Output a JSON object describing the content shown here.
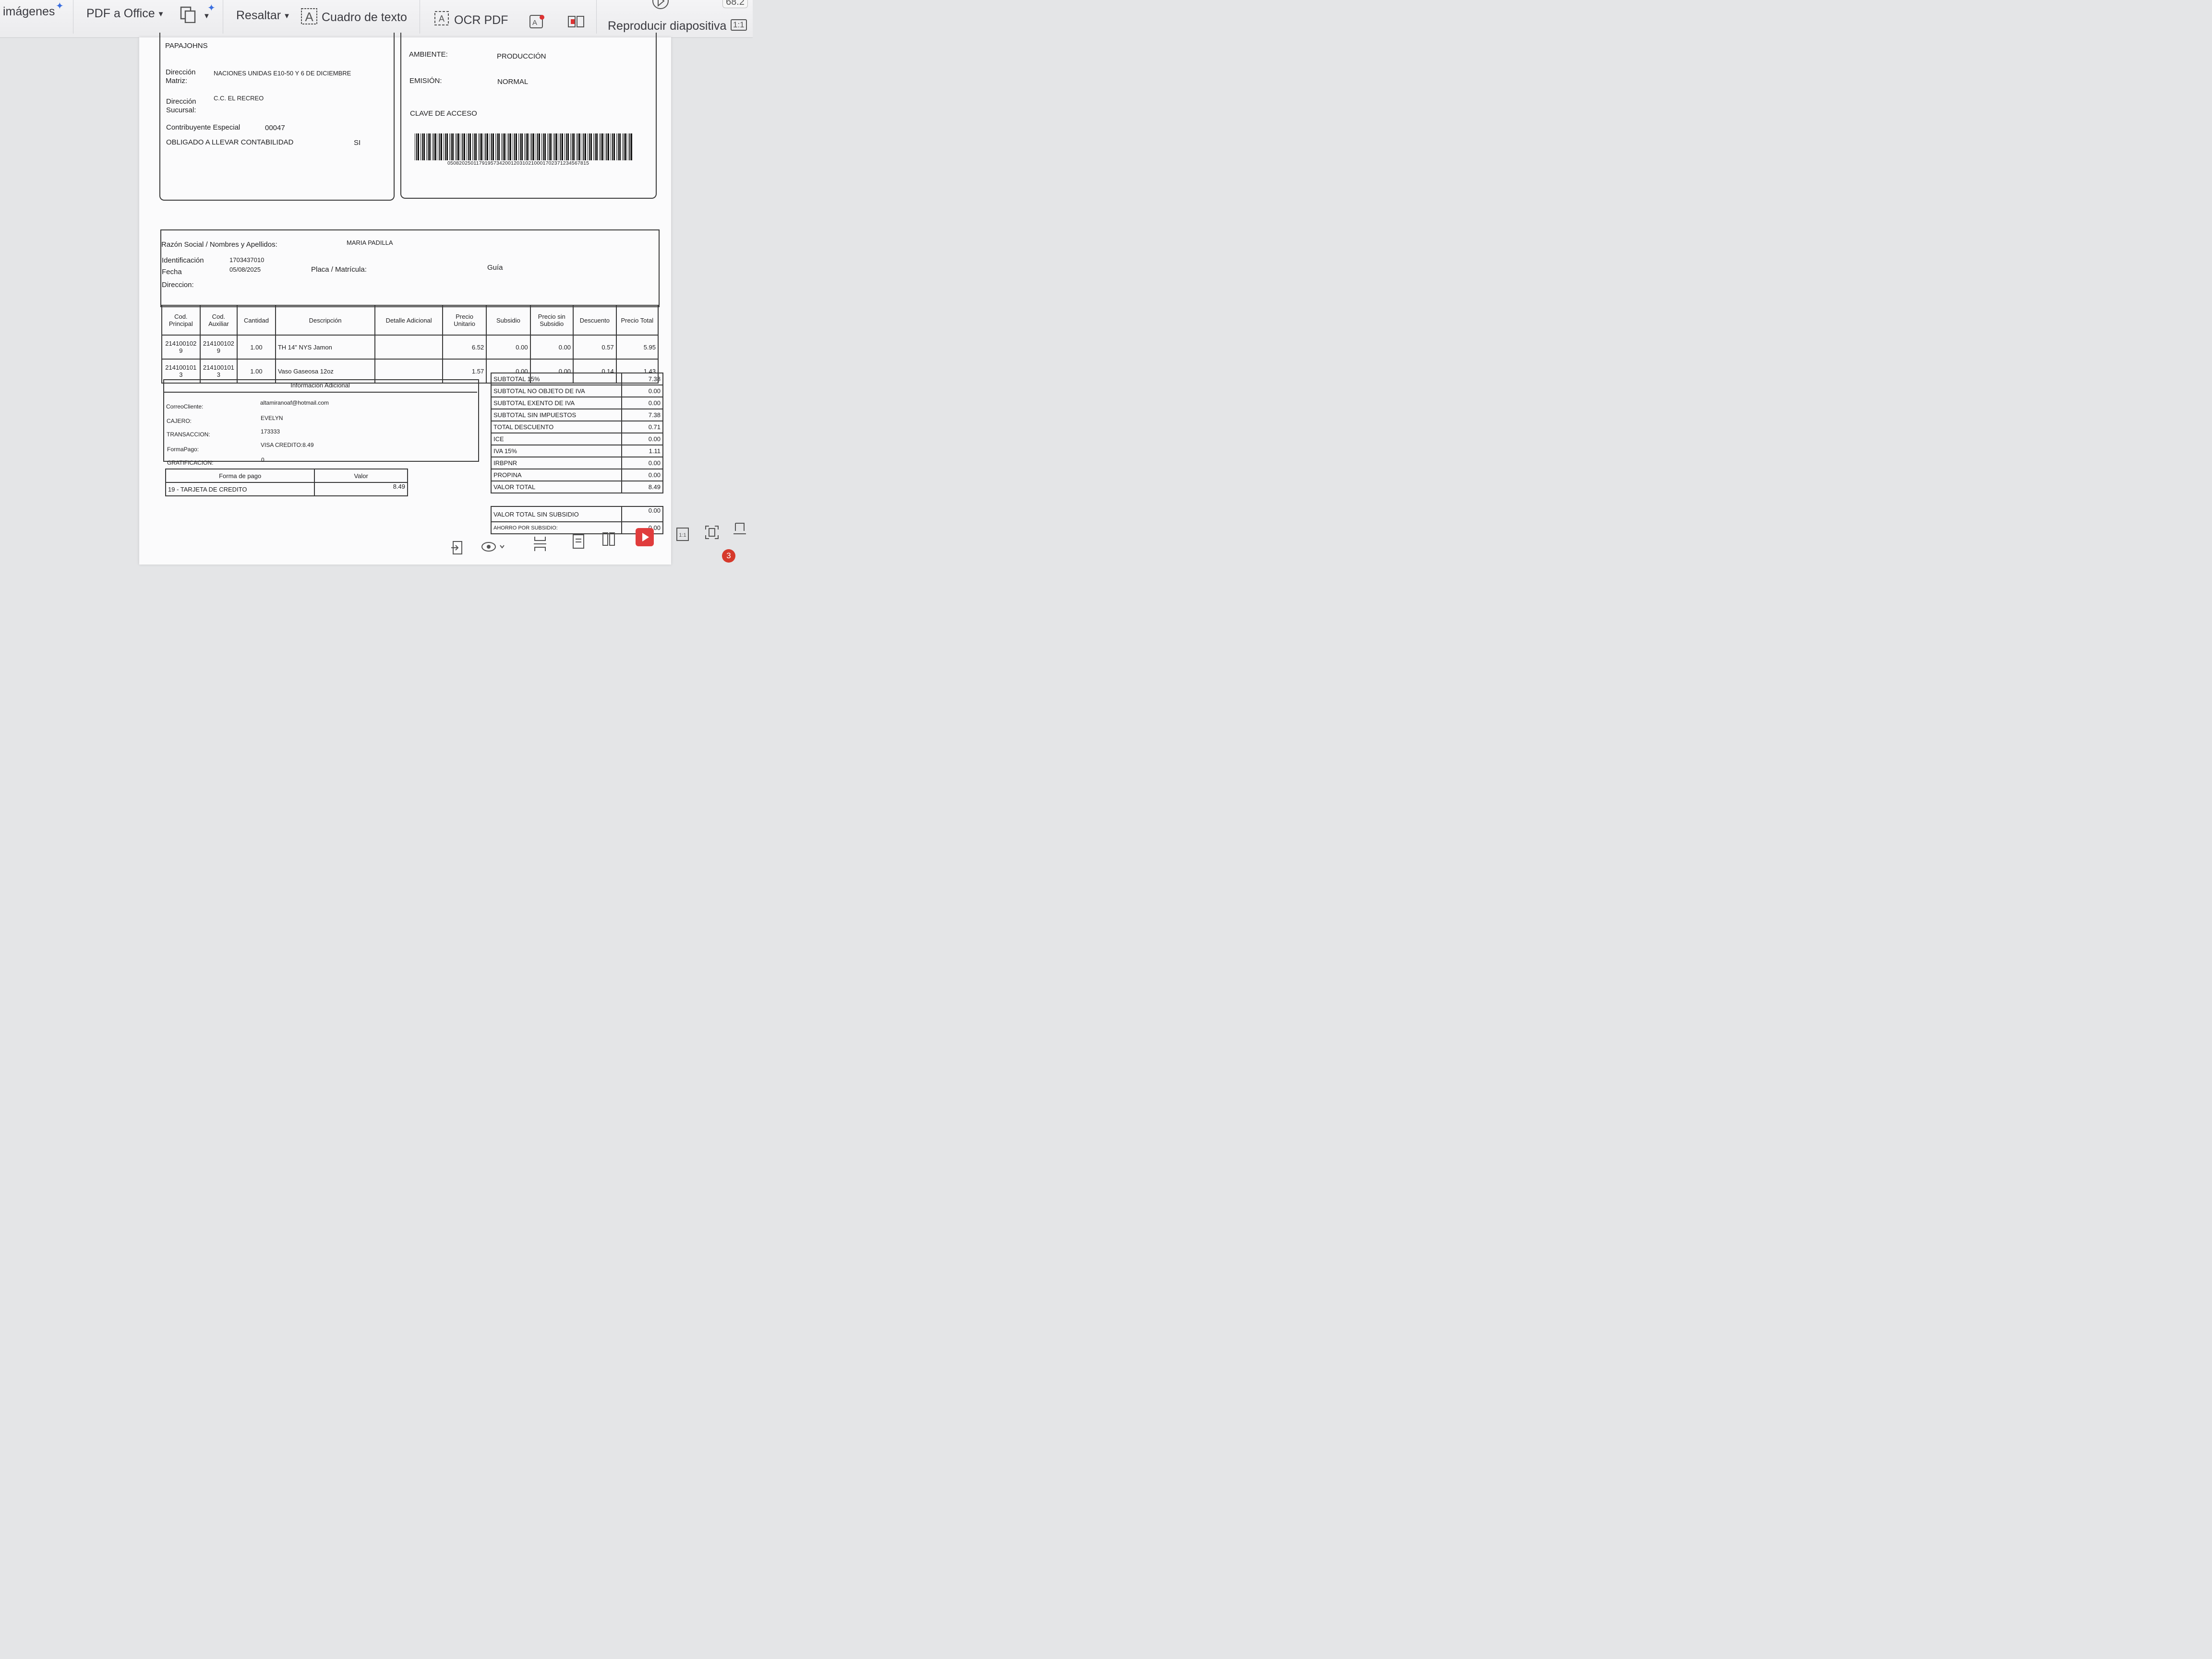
{
  "toolbar": {
    "images": "imágenes",
    "pdf_office": "PDF a Office",
    "highlight": "Resaltar",
    "textbox": "Cuadro de texto",
    "ocr": "OCR PDF",
    "slideshow": "Reproducir diapositiva",
    "zoom": "68.2",
    "fit_label": "1:1"
  },
  "header": {
    "company": "PAPAJOHNS",
    "matriz_label": "Dirección Matriz:",
    "matriz_value": "NACIONES UNIDAS E10-50 Y 6 DE DICIEMBRE",
    "sucursal_label": "Dirección Sucursal:",
    "sucursal_value": "C.C. EL RECREO",
    "contribuyente_label": "Contribuyente Especial",
    "contribuyente_value": "00047",
    "obligado_label": "OBLIGADO A LLEVAR CONTABILIDAD",
    "obligado_value": "SI",
    "ambiente_label": "AMBIENTE:",
    "ambiente_value": "PRODUCCIÓN",
    "emision_label": "EMISIÓN:",
    "emision_value": "NORMAL",
    "clave_label": "CLAVE DE ACCESO",
    "clave_value": "0508202501179195734200120310210001702371234567815"
  },
  "client": {
    "razon_label": "Razón Social / Nombres y Apellidos:",
    "razon_value": "MARIA PADILLA",
    "id_label": "Identificación",
    "id_value": "1703437010",
    "fecha_label": "Fecha",
    "fecha_value": "05/08/2025",
    "placa_label": "Placa / Matrícula:",
    "guia_label": "Guía",
    "direccion_label": "Direccion:"
  },
  "items": {
    "headers": [
      "Cod. Principal",
      "Cod. Auxiliar",
      "Cantidad",
      "Descripción",
      "Detalle Adicional",
      "Precio Unitario",
      "Subsidio",
      "Precio sin Subsidio",
      "Descuento",
      "Precio Total"
    ],
    "rows": [
      {
        "cod": "2141001029",
        "aux": "2141001029",
        "cant": "1.00",
        "desc": "TH 14\" NYS Jamon",
        "det": "",
        "pu": "6.52",
        "sub": "0.00",
        "psub": "0.00",
        "desc_amt": "0.57",
        "total": "5.95"
      },
      {
        "cod": "2141001013",
        "aux": "2141001013",
        "cant": "1.00",
        "desc": "Vaso Gaseosa 12oz",
        "det": "",
        "pu": "1.57",
        "sub": "0.00",
        "psub": "0.00",
        "desc_amt": "0.14",
        "total": "1.43"
      }
    ]
  },
  "info": {
    "title": "Información Adicional",
    "correo_label": "CorreoCliente:",
    "correo_value": "altamiranoaf@hotmail.com",
    "cajero_label": "CAJERO:",
    "cajero_value": "EVELYN",
    "transaccion_label": "TRANSACCION:",
    "transaccion_value": "173333",
    "forma_label": "FormaPago:",
    "forma_value": "VISA CREDITO:8.49",
    "grat_label": "GRATIFICACION:",
    "grat_value": "0"
  },
  "payment": {
    "col1": "Forma de pago",
    "col2": "Valor",
    "method": "19 - TARJETA DE CREDITO",
    "amount": "8.49"
  },
  "totals": [
    {
      "label": "SUBTOTAL 15%",
      "value": "7.38"
    },
    {
      "label": "SUBTOTAL NO OBJETO DE IVA",
      "value": "0.00"
    },
    {
      "label": "SUBTOTAL EXENTO DE IVA",
      "value": "0.00"
    },
    {
      "label": "SUBTOTAL SIN IMPUESTOS",
      "value": "7.38"
    },
    {
      "label": "TOTAL DESCUENTO",
      "value": "0.71"
    },
    {
      "label": "ICE",
      "value": "0.00"
    },
    {
      "label": "IVA 15%",
      "value": "1.11"
    },
    {
      "label": "IRBPNR",
      "value": "0.00"
    },
    {
      "label": "PROPINA",
      "value": "0.00"
    },
    {
      "label": "VALOR TOTAL",
      "value": "8.49"
    }
  ],
  "total_sin_subsidio": {
    "label": "VALOR TOTAL SIN SUBSIDIO",
    "value": "0.00"
  },
  "ahorro": {
    "label": "AHORRO POR SUBSIDIO:",
    "value": "0.00"
  },
  "statusbar": {
    "badge": "3"
  }
}
